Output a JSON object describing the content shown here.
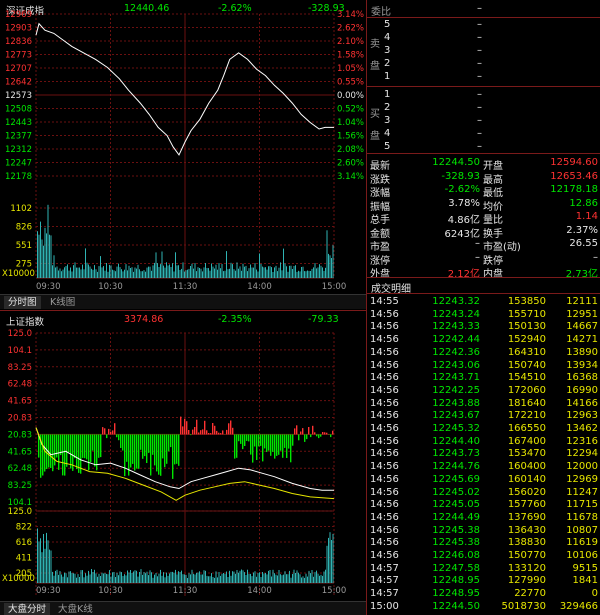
{
  "top_chart": {
    "index_name": "深证成指",
    "last": "12440.46",
    "pct": "-2.62%",
    "chg": "-328.93",
    "left_ticks": [
      "12969",
      "12903",
      "12836",
      "12773",
      "12707",
      "12642",
      "12573",
      "12508",
      "12443",
      "12377",
      "12312",
      "12247",
      "12178"
    ],
    "right_ticks": [
      "3.14%",
      "2.62%",
      "2.10%",
      "1.58%",
      "1.05%",
      "0.55%",
      "0.00%",
      "0.52%",
      "1.04%",
      "1.56%",
      "2.08%",
      "2.60%",
      "3.14%"
    ],
    "volume_ticks": [
      "1102",
      "826",
      "551",
      "275"
    ],
    "volume_unit": "X10000",
    "time_labels": [
      "09:30",
      "10:30",
      "11:30",
      "14:00",
      "15:00"
    ],
    "tabs": [
      "分时图",
      "K线图"
    ]
  },
  "bottom_chart": {
    "index_name": "上证指数",
    "last": "3374.86",
    "pct": "-2.35%",
    "chg": "-79.33",
    "left_ticks": [
      "125.0",
      "104.1",
      "83.25",
      "62.48",
      "41.65",
      "20.83",
      "20.83",
      "41.65",
      "62.48",
      "83.25",
      "104.1"
    ],
    "volume_ticks": [
      "125.0",
      "822",
      "616",
      "411",
      "205"
    ],
    "volume_unit": "X10000",
    "time_labels": [
      "09:30",
      "10:30",
      "11:30",
      "14:00",
      "15:00"
    ],
    "tabs": [
      "大盘分时",
      "大盘K线"
    ]
  },
  "order_book": {
    "title": "委比",
    "title_value": "–",
    "sell_label": "卖盘",
    "buy_label": "买盘",
    "sell_levels": [
      {
        "n": "5",
        "v": "–"
      },
      {
        "n": "4",
        "v": "–"
      },
      {
        "n": "3",
        "v": "–"
      },
      {
        "n": "2",
        "v": "–"
      },
      {
        "n": "1",
        "v": "–"
      }
    ],
    "buy_levels": [
      {
        "n": "1",
        "v": "–"
      },
      {
        "n": "2",
        "v": "–"
      },
      {
        "n": "3",
        "v": "–"
      },
      {
        "n": "4",
        "v": "–"
      },
      {
        "n": "5",
        "v": "–"
      }
    ]
  },
  "quote": [
    {
      "l1": "最新",
      "v1": "12244.50",
      "l2": "开盘",
      "v2": "12594.60",
      "c1": "grn",
      "c2": "red"
    },
    {
      "l1": "涨跌",
      "v1": "-328.93",
      "l2": "最高",
      "v2": "12653.46",
      "c1": "grn",
      "c2": "red"
    },
    {
      "l1": "涨幅",
      "v1": "-2.62%",
      "l2": "最低",
      "v2": "12178.18",
      "c1": "grn",
      "c2": "grn"
    },
    {
      "l1": "振幅",
      "v1": "3.78%",
      "l2": "均价",
      "v2": "12.86",
      "c1": "wht",
      "c2": "grn"
    },
    {
      "l1": "总手",
      "v1": "4.86亿",
      "l2": "量比",
      "v2": "1.14",
      "c1": "wht",
      "c2": "red"
    },
    {
      "l1": "金额",
      "v1": "6243亿",
      "l2": "换手",
      "v2": "2.37%",
      "c1": "wht",
      "c2": "wht"
    },
    {
      "l1": "市盈",
      "v1": "–",
      "l2": "市盈(动)",
      "v2": "26.55",
      "c1": "wht",
      "c2": "wht"
    },
    {
      "l1": "涨停",
      "v1": "–",
      "l2": "跌停",
      "v2": "–",
      "c1": "wht",
      "c2": "wht"
    },
    {
      "l1": "外盘",
      "v1": "2.12亿",
      "l2": "内盘",
      "v2": "2.73亿",
      "c1": "red",
      "c2": "grn"
    }
  ],
  "trades_title": "成交明细",
  "trades": [
    [
      "14:55",
      "12243.32",
      "153850",
      "12111"
    ],
    [
      "14:56",
      "12243.24",
      "155710",
      "12951"
    ],
    [
      "14:56",
      "12243.33",
      "150130",
      "14667"
    ],
    [
      "14:56",
      "12242.44",
      "152940",
      "14271"
    ],
    [
      "14:56",
      "12242.36",
      "164310",
      "13890"
    ],
    [
      "14:56",
      "12243.06",
      "150740",
      "13934"
    ],
    [
      "14:56",
      "12243.71",
      "154510",
      "16368"
    ],
    [
      "14:56",
      "12242.25",
      "172060",
      "16990"
    ],
    [
      "14:56",
      "12243.88",
      "181640",
      "14166"
    ],
    [
      "14:56",
      "12243.67",
      "172210",
      "12963"
    ],
    [
      "14:56",
      "12245.32",
      "166550",
      "13462"
    ],
    [
      "14:56",
      "12244.40",
      "167400",
      "12316"
    ],
    [
      "14:56",
      "12243.73",
      "153470",
      "12294"
    ],
    [
      "14:56",
      "12244.76",
      "160400",
      "12000"
    ],
    [
      "14:56",
      "12245.69",
      "160140",
      "12969"
    ],
    [
      "14:56",
      "12245.02",
      "156020",
      "11247"
    ],
    [
      "14:56",
      "12245.05",
      "157760",
      "11715"
    ],
    [
      "14:56",
      "12244.49",
      "137690",
      "11678"
    ],
    [
      "14:56",
      "12245.38",
      "136430",
      "10807"
    ],
    [
      "14:56",
      "12245.38",
      "138830",
      "11619"
    ],
    [
      "14:56",
      "12246.08",
      "150770",
      "10106"
    ],
    [
      "14:57",
      "12247.58",
      "133120",
      "9515"
    ],
    [
      "14:57",
      "12248.95",
      "127990",
      "1841"
    ],
    [
      "14:57",
      "12248.95",
      "22770",
      "0"
    ],
    [
      "15:00",
      "12244.50",
      "5018730",
      "329466"
    ]
  ],
  "colors": {
    "up": "#ff3232",
    "down": "#00e600",
    "price_line": "#ffffff",
    "avg_line": "#e6e600",
    "grid": "#6a1010",
    "volume": "#2fb3b3"
  }
}
